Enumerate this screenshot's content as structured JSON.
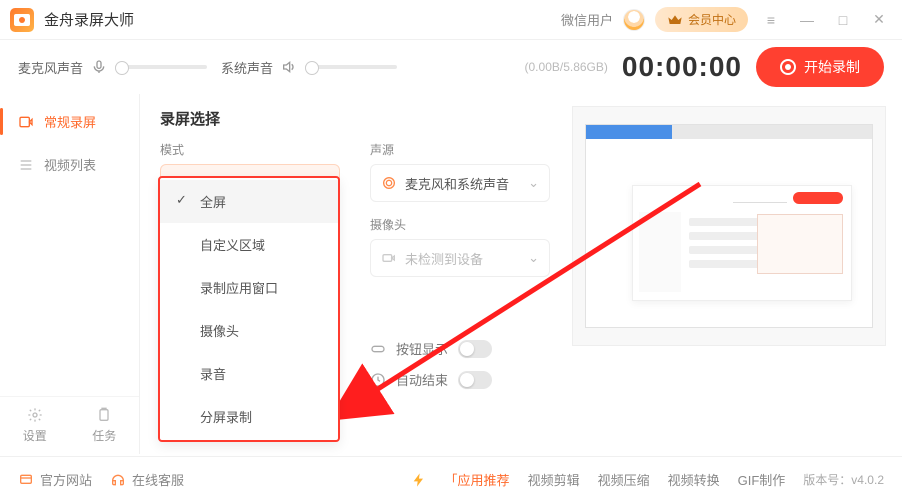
{
  "app": {
    "title": "金舟录屏大师"
  },
  "titlebar": {
    "wechat_user": "微信用户",
    "member_center": "会员中心"
  },
  "top": {
    "mic_label": "麦克风声音",
    "sys_label": "系统声音",
    "storage": "(0.00B/5.86GB)",
    "timer": "00:00:00",
    "record_btn": "开始录制"
  },
  "sidebar": {
    "items": [
      {
        "label": "常规录屏"
      },
      {
        "label": "视频列表"
      }
    ],
    "settings": "设置",
    "tasks": "任务"
  },
  "content": {
    "section_title": "录屏选择",
    "mode_label": "模式",
    "mode_value": "全屏",
    "source_label": "声源",
    "source_value": "麦克风和系统声音",
    "camera_label": "摄像头",
    "camera_value": "未检测到设备",
    "button_show": "按钮显示",
    "auto_end": "自动结束"
  },
  "dropdown": {
    "options": [
      "全屏",
      "自定义区域",
      "录制应用窗口",
      "摄像头",
      "录音",
      "分屏录制"
    ]
  },
  "footer": {
    "official_site": "官方网站",
    "online_service": "在线客服",
    "app_recommend": "「应用推荐",
    "video_edit": "视频剪辑",
    "video_compress": "视频压缩",
    "video_convert": "视频转换",
    "gif_make": "GIF制作",
    "version_label": "版本号：",
    "version": "v4.0.2"
  }
}
